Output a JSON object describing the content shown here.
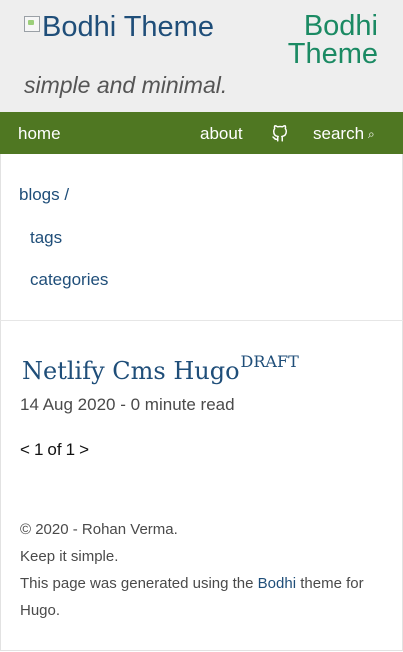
{
  "header": {
    "logo_alt": "Bodhi Theme",
    "site_title": "Bodhi Theme",
    "tagline": "simple and minimal."
  },
  "nav": {
    "home": "home",
    "about": "about",
    "github_icon": "github-icon",
    "search": "search",
    "search_icon": "⌕"
  },
  "sidebar": {
    "blogs": "blogs",
    "separator": "/",
    "tags": "tags",
    "categories": "categories"
  },
  "post": {
    "title": "Netlify Cms Hugo",
    "badge": "DRAFT",
    "date": "14 Aug 2020",
    "meta_sep": "-",
    "read_time": "0 minute read"
  },
  "pager": {
    "prev": "<",
    "current": "1",
    "of": "of",
    "total": "1",
    "next": ">"
  },
  "footer": {
    "copyright": "© 2020 - Rohan Verma.",
    "motto": "Keep it simple.",
    "generated_prefix": "This page was generated using the",
    "theme_link": "Bodhi",
    "generated_suffix": "theme for Hugo."
  },
  "colors": {
    "nav_bg": "#4f7722",
    "header_bg": "#eeeeee",
    "link": "#1f4e79",
    "title_green": "#1b8a63"
  }
}
